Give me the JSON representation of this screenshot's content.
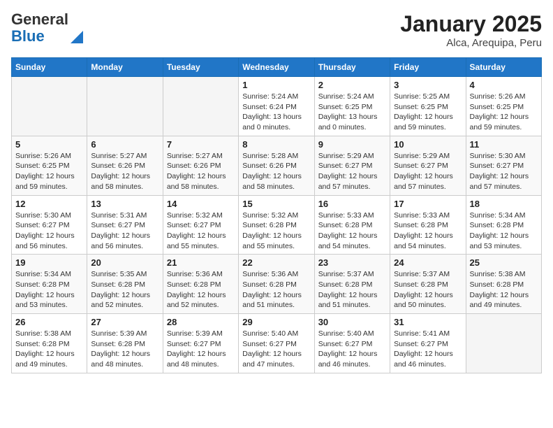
{
  "logo": {
    "general": "General",
    "blue": "Blue"
  },
  "title": "January 2025",
  "location": "Alca, Arequipa, Peru",
  "days_of_week": [
    "Sunday",
    "Monday",
    "Tuesday",
    "Wednesday",
    "Thursday",
    "Friday",
    "Saturday"
  ],
  "weeks": [
    [
      {
        "num": "",
        "info": ""
      },
      {
        "num": "",
        "info": ""
      },
      {
        "num": "",
        "info": ""
      },
      {
        "num": "1",
        "info": "Sunrise: 5:24 AM\nSunset: 6:24 PM\nDaylight: 13 hours\nand 0 minutes."
      },
      {
        "num": "2",
        "info": "Sunrise: 5:24 AM\nSunset: 6:25 PM\nDaylight: 13 hours\nand 0 minutes."
      },
      {
        "num": "3",
        "info": "Sunrise: 5:25 AM\nSunset: 6:25 PM\nDaylight: 12 hours\nand 59 minutes."
      },
      {
        "num": "4",
        "info": "Sunrise: 5:26 AM\nSunset: 6:25 PM\nDaylight: 12 hours\nand 59 minutes."
      }
    ],
    [
      {
        "num": "5",
        "info": "Sunrise: 5:26 AM\nSunset: 6:25 PM\nDaylight: 12 hours\nand 59 minutes."
      },
      {
        "num": "6",
        "info": "Sunrise: 5:27 AM\nSunset: 6:26 PM\nDaylight: 12 hours\nand 58 minutes."
      },
      {
        "num": "7",
        "info": "Sunrise: 5:27 AM\nSunset: 6:26 PM\nDaylight: 12 hours\nand 58 minutes."
      },
      {
        "num": "8",
        "info": "Sunrise: 5:28 AM\nSunset: 6:26 PM\nDaylight: 12 hours\nand 58 minutes."
      },
      {
        "num": "9",
        "info": "Sunrise: 5:29 AM\nSunset: 6:27 PM\nDaylight: 12 hours\nand 57 minutes."
      },
      {
        "num": "10",
        "info": "Sunrise: 5:29 AM\nSunset: 6:27 PM\nDaylight: 12 hours\nand 57 minutes."
      },
      {
        "num": "11",
        "info": "Sunrise: 5:30 AM\nSunset: 6:27 PM\nDaylight: 12 hours\nand 57 minutes."
      }
    ],
    [
      {
        "num": "12",
        "info": "Sunrise: 5:30 AM\nSunset: 6:27 PM\nDaylight: 12 hours\nand 56 minutes."
      },
      {
        "num": "13",
        "info": "Sunrise: 5:31 AM\nSunset: 6:27 PM\nDaylight: 12 hours\nand 56 minutes."
      },
      {
        "num": "14",
        "info": "Sunrise: 5:32 AM\nSunset: 6:27 PM\nDaylight: 12 hours\nand 55 minutes."
      },
      {
        "num": "15",
        "info": "Sunrise: 5:32 AM\nSunset: 6:28 PM\nDaylight: 12 hours\nand 55 minutes."
      },
      {
        "num": "16",
        "info": "Sunrise: 5:33 AM\nSunset: 6:28 PM\nDaylight: 12 hours\nand 54 minutes."
      },
      {
        "num": "17",
        "info": "Sunrise: 5:33 AM\nSunset: 6:28 PM\nDaylight: 12 hours\nand 54 minutes."
      },
      {
        "num": "18",
        "info": "Sunrise: 5:34 AM\nSunset: 6:28 PM\nDaylight: 12 hours\nand 53 minutes."
      }
    ],
    [
      {
        "num": "19",
        "info": "Sunrise: 5:34 AM\nSunset: 6:28 PM\nDaylight: 12 hours\nand 53 minutes."
      },
      {
        "num": "20",
        "info": "Sunrise: 5:35 AM\nSunset: 6:28 PM\nDaylight: 12 hours\nand 52 minutes."
      },
      {
        "num": "21",
        "info": "Sunrise: 5:36 AM\nSunset: 6:28 PM\nDaylight: 12 hours\nand 52 minutes."
      },
      {
        "num": "22",
        "info": "Sunrise: 5:36 AM\nSunset: 6:28 PM\nDaylight: 12 hours\nand 51 minutes."
      },
      {
        "num": "23",
        "info": "Sunrise: 5:37 AM\nSunset: 6:28 PM\nDaylight: 12 hours\nand 51 minutes."
      },
      {
        "num": "24",
        "info": "Sunrise: 5:37 AM\nSunset: 6:28 PM\nDaylight: 12 hours\nand 50 minutes."
      },
      {
        "num": "25",
        "info": "Sunrise: 5:38 AM\nSunset: 6:28 PM\nDaylight: 12 hours\nand 49 minutes."
      }
    ],
    [
      {
        "num": "26",
        "info": "Sunrise: 5:38 AM\nSunset: 6:28 PM\nDaylight: 12 hours\nand 49 minutes."
      },
      {
        "num": "27",
        "info": "Sunrise: 5:39 AM\nSunset: 6:28 PM\nDaylight: 12 hours\nand 48 minutes."
      },
      {
        "num": "28",
        "info": "Sunrise: 5:39 AM\nSunset: 6:27 PM\nDaylight: 12 hours\nand 48 minutes."
      },
      {
        "num": "29",
        "info": "Sunrise: 5:40 AM\nSunset: 6:27 PM\nDaylight: 12 hours\nand 47 minutes."
      },
      {
        "num": "30",
        "info": "Sunrise: 5:40 AM\nSunset: 6:27 PM\nDaylight: 12 hours\nand 46 minutes."
      },
      {
        "num": "31",
        "info": "Sunrise: 5:41 AM\nSunset: 6:27 PM\nDaylight: 12 hours\nand 46 minutes."
      },
      {
        "num": "",
        "info": ""
      }
    ]
  ]
}
